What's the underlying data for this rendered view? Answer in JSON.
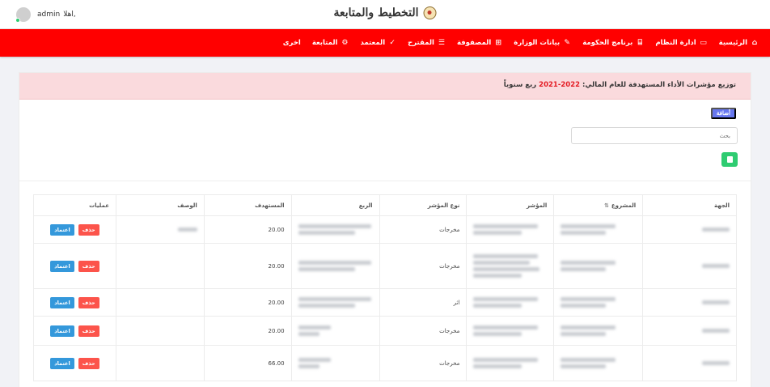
{
  "header": {
    "app_title": "التخطيط والمتابعة",
    "greeting": "اهلا,",
    "username": "admin"
  },
  "nav": {
    "items": [
      {
        "label": "الرئيسية",
        "icon": "home-icon",
        "glyph": "⌂"
      },
      {
        "label": "ادارة النظام",
        "icon": "monitor-icon",
        "glyph": "▭"
      },
      {
        "label": "برنامج الحكومة",
        "icon": "institution-icon",
        "glyph": "⌸"
      },
      {
        "label": "بيانات الوزارة",
        "icon": "edit-icon",
        "glyph": "✎"
      },
      {
        "label": "المصفوفة",
        "icon": "grid-icon",
        "glyph": "⊞"
      },
      {
        "label": "المقترح",
        "icon": "list-icon",
        "glyph": "☰"
      },
      {
        "label": "المعتمد",
        "icon": "check-icon",
        "glyph": "✓"
      },
      {
        "label": "المتابعة",
        "icon": "cogs-icon",
        "glyph": "⚙"
      },
      {
        "label": "اخرى",
        "icon": "",
        "glyph": ""
      }
    ]
  },
  "alert": {
    "prefix": "توزيع مؤشرات الأداء المستهدفة للعام المالي:",
    "year": "2022-2021",
    "suffix": "ربع سنوياً"
  },
  "actions": {
    "add_label": "أضافة",
    "search_placeholder": "بحث"
  },
  "table": {
    "headers": {
      "entity": "الجهة",
      "project": "المشروع",
      "indicator": "المؤشر",
      "type": "نوع المؤشر",
      "quarter": "الربع",
      "target": "المستهدف",
      "description": "الوصف",
      "operations": "عمليات"
    },
    "approve_label": "اعتماد",
    "delete_label": "حذف",
    "rows": [
      {
        "type": "مخرجات",
        "target": "20.00"
      },
      {
        "type": "مخرجات",
        "target": "20.00"
      },
      {
        "type": "اثر",
        "target": "20.00"
      },
      {
        "type": "مخرجات",
        "target": "20.00"
      },
      {
        "type": "مخرجات",
        "target": "66.00"
      }
    ]
  },
  "colors": {
    "navbar": "#ff0000",
    "alert_bg": "#fadadd",
    "alert_year": "#e41b23",
    "add_button": "#6777ef",
    "approve_button": "#3498db",
    "delete_button": "#fc544b",
    "excel_button": "#2ecc71"
  }
}
